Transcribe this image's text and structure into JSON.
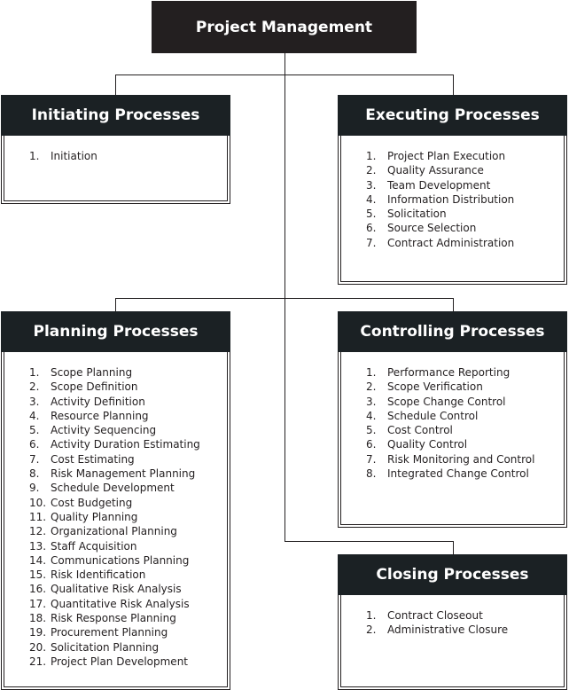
{
  "root": "Project Management",
  "boxes": [
    {
      "id": "initiating",
      "title": "Initiating Processes",
      "items": [
        "Initiation"
      ]
    },
    {
      "id": "executing",
      "title": "Executing Processes",
      "items": [
        "Project Plan Execution",
        "Quality Assurance",
        "Team Development",
        "Information Distribution",
        "Solicitation",
        "Source Selection",
        "Contract Administration"
      ]
    },
    {
      "id": "planning",
      "title": "Planning Processes",
      "items": [
        "Scope Planning",
        "Scope Definition",
        "Activity Definition",
        "Resource Planning",
        "Activity Sequencing",
        "Activity Duration Estimating",
        "Cost Estimating",
        "Risk Management Planning",
        "Schedule Development",
        "Cost Budgeting",
        "Quality Planning",
        "Organizational Planning",
        "Staff Acquisition",
        "Communications Planning",
        "Risk Identification",
        "Qualitative Risk Analysis",
        "Quantitative Risk Analysis",
        "Risk Response Planning",
        "Procurement Planning",
        "Solicitation Planning",
        "Project Plan Development"
      ]
    },
    {
      "id": "controlling",
      "title": "Controlling Processes",
      "items": [
        "Performance Reporting",
        "Scope Verification",
        "Scope Change Control",
        "Schedule Control",
        "Cost Control",
        "Quality Control",
        "Risk Monitoring and Control",
        "Integrated Change Control"
      ]
    },
    {
      "id": "closing",
      "title": "Closing Processes",
      "items": [
        "Contract Closeout",
        "Administrative Closure"
      ]
    }
  ]
}
